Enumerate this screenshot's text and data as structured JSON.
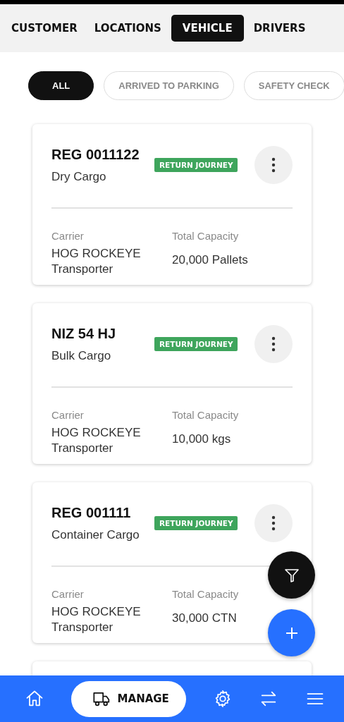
{
  "tabs": [
    {
      "label": "CUSTOMER",
      "selected": false
    },
    {
      "label": "LOCATIONS",
      "selected": false
    },
    {
      "label": "VEHICLE",
      "selected": true
    },
    {
      "label": "DRIVERS",
      "selected": false
    }
  ],
  "filters": [
    {
      "label": "ALL",
      "selected": true
    },
    {
      "label": "ARRIVED TO PARKING",
      "selected": false
    },
    {
      "label": "SAFETY CHECK",
      "selected": false
    }
  ],
  "vehicles": [
    {
      "kind": "card",
      "registration": "REG 0011122",
      "cargo": "Dry Cargo",
      "badge": "RETURN JOURNEY",
      "carrier_label": "Carrier",
      "carrier": "HOG ROCKEYE Transporter",
      "capacity_label": "Total Capacity",
      "capacity": "20,000 Pallets"
    },
    {
      "kind": "card",
      "registration": "NIZ 54 HJ",
      "cargo": "Bulk Cargo",
      "badge": "RETURN JOURNEY",
      "carrier_label": "Carrier",
      "carrier": "HOG ROCKEYE Transporter",
      "capacity_label": "Total Capacity",
      "capacity": "10,000 kgs"
    },
    {
      "kind": "card",
      "registration": "REG 001111",
      "cargo": "Container Cargo",
      "badge": "RETURN JOURNEY",
      "carrier_label": "Carrier",
      "carrier": "HOG ROCKEYE Transporter",
      "capacity_label": "Total Capacity",
      "capacity": "30,000 CTN"
    },
    {
      "kind": "partial"
    }
  ],
  "bottom_nav": [
    {
      "kind": "home",
      "selected": false
    },
    {
      "kind": "manage",
      "label": "MANAGE",
      "selected": true
    },
    {
      "kind": "settings",
      "selected": false
    },
    {
      "kind": "transfer",
      "selected": false
    },
    {
      "kind": "menu",
      "selected": false
    }
  ]
}
